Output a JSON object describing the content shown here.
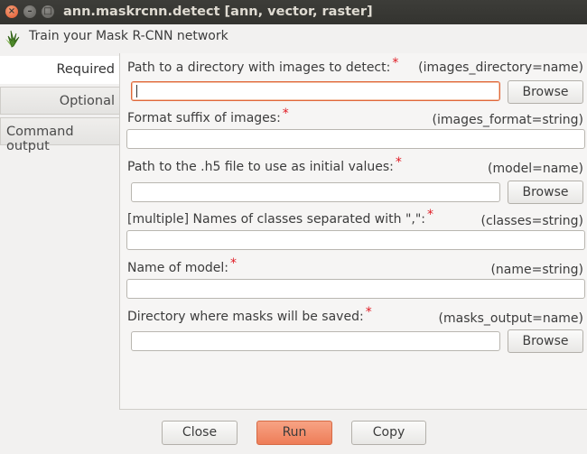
{
  "window": {
    "title": "ann.maskrcnn.detect [ann, vector, raster]",
    "close_glyph": "×",
    "minimize_glyph": "–",
    "maximize_glyph": "□"
  },
  "header": {
    "text": "Train your Mask R-CNN network",
    "logo_icon": "grass-logo-icon"
  },
  "tabs": [
    {
      "label": "Required"
    },
    {
      "label": "Optional"
    },
    {
      "label": "Command output"
    }
  ],
  "required_marker": "*",
  "fields": [
    {
      "label": "Path to a directory with images to detect:",
      "key": "(images_directory=name)",
      "value": "",
      "has_browse": true
    },
    {
      "label": "Format suffix of images:",
      "key": "(images_format=string)",
      "value": ""
    },
    {
      "label": "Path to the .h5 file to use as initial values:",
      "key": "(model=name)",
      "value": "",
      "has_browse": true
    },
    {
      "label": "[multiple] Names of classes separated with \",\":",
      "key": "(classes=string)",
      "value": ""
    },
    {
      "label": "Name of model:",
      "key": "(name=string)",
      "value": ""
    },
    {
      "label": "Directory where masks will be saved:",
      "key": "(masks_output=name)",
      "value": "",
      "has_browse": true
    }
  ],
  "browse_label": "Browse",
  "buttons": {
    "close": "Close",
    "run": "Run",
    "copy": "Copy"
  },
  "colors": {
    "accent": "#ee7d58",
    "required": "#e01b24",
    "titlebar": "#3a3a36"
  }
}
